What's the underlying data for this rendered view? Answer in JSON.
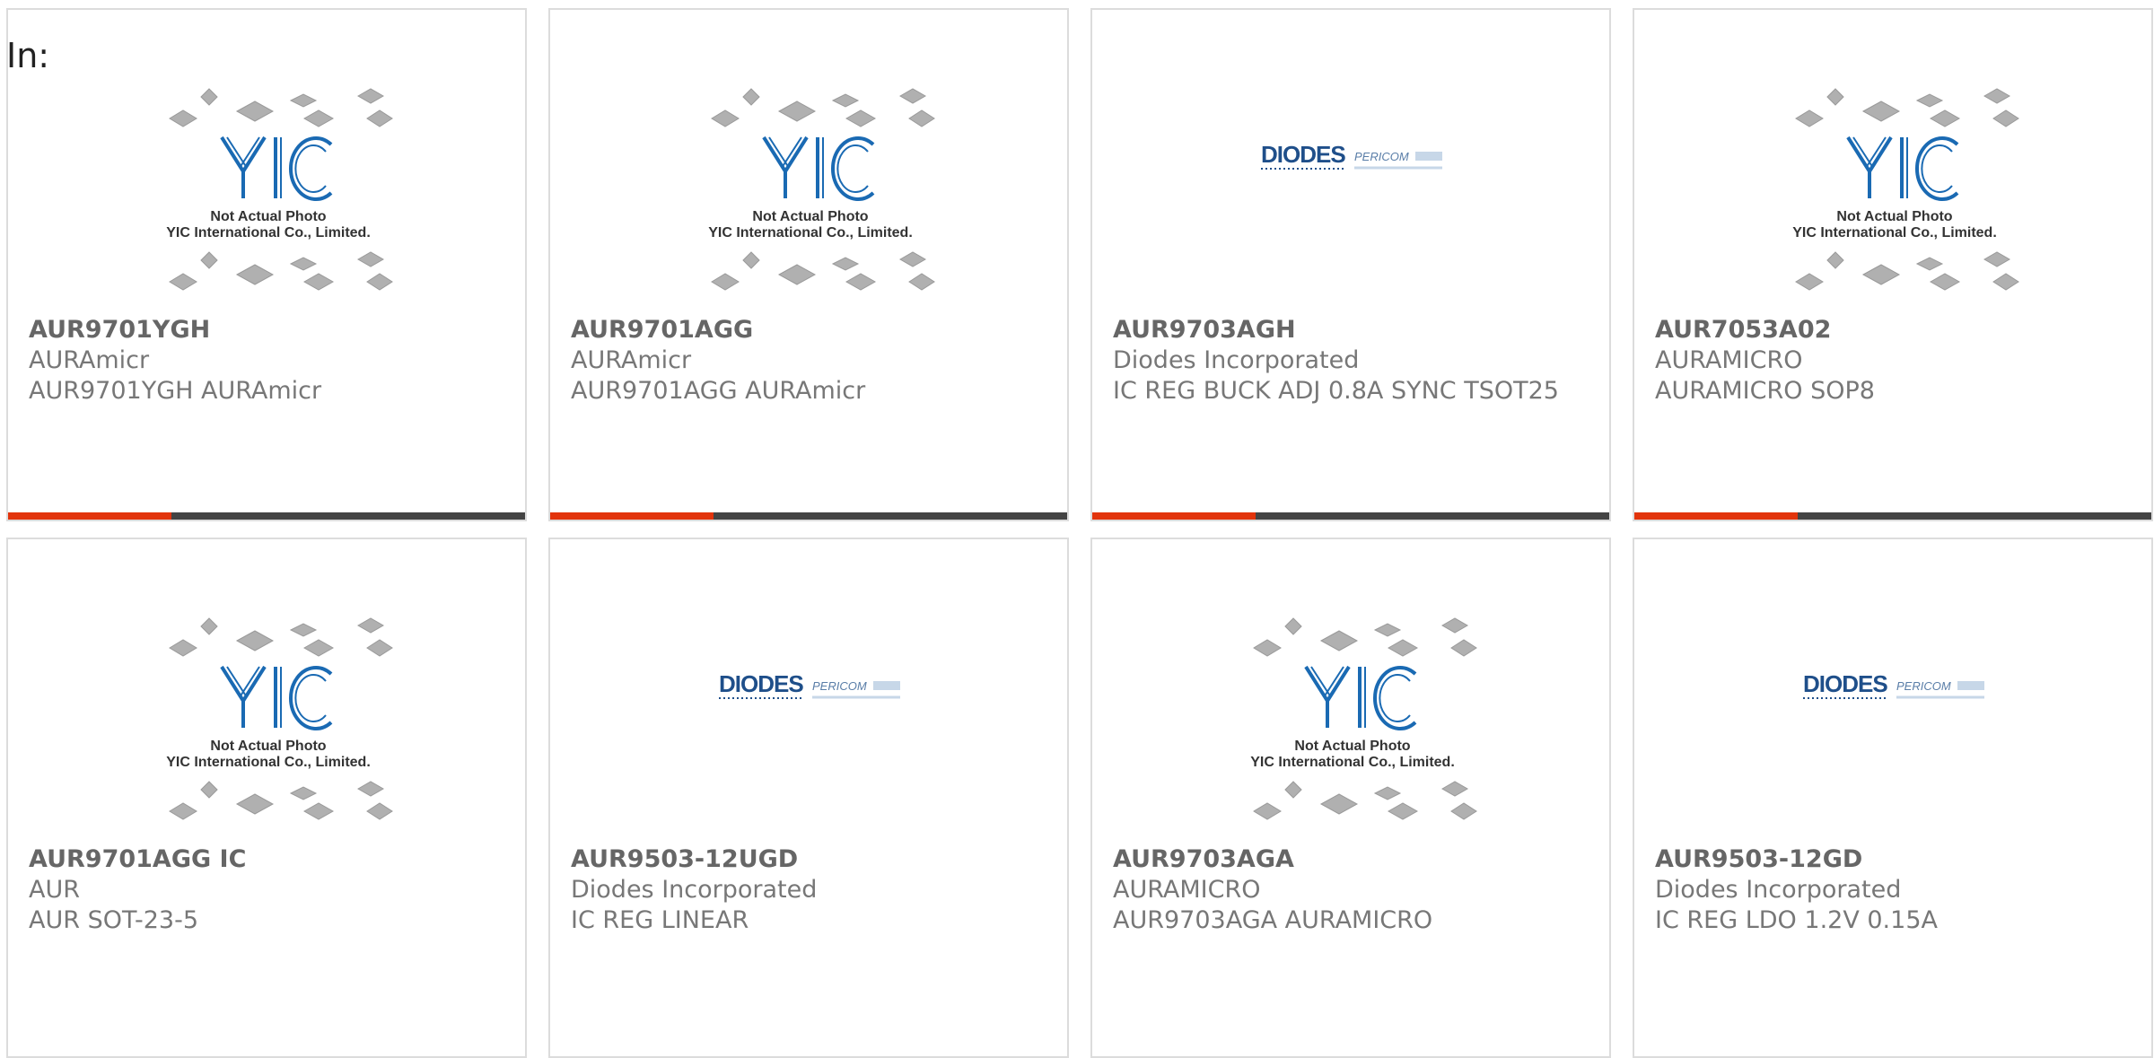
{
  "header": {
    "label": "In:"
  },
  "placeholder": {
    "caption_line1": "Not Actual Photo",
    "caption_line2": "YIC International Co., Limited.",
    "logo_text": "YIC"
  },
  "diodes_logo": {
    "brand": "DIODES",
    "sub_brand": "PERICOM"
  },
  "colors": {
    "accent": "#e2340c",
    "bar": "#444444",
    "logo_blue": "#1a6ab3"
  },
  "products": [
    {
      "part": "AUR9701YGH",
      "maker": "AURAmicr",
      "desc": "AUR9701YGH AURAmicr",
      "image": "yic-placeholder"
    },
    {
      "part": "AUR9701AGG",
      "maker": "AURAmicr",
      "desc": "AUR9701AGG AURAmicr",
      "image": "yic-placeholder"
    },
    {
      "part": "AUR9703AGH",
      "maker": "Diodes Incorporated",
      "desc": "IC REG BUCK ADJ 0.8A SYNC TSOT25",
      "image": "diodes-logo"
    },
    {
      "part": "AUR7053A02",
      "maker": "AURAMICRO",
      "desc": "AURAMICRO SOP8",
      "image": "yic-placeholder"
    },
    {
      "part": "AUR9701AGG IC",
      "maker": "AUR",
      "desc": "AUR SOT-23-5",
      "image": "yic-placeholder"
    },
    {
      "part": "AUR9503-12UGD",
      "maker": "Diodes Incorporated",
      "desc": "IC REG LINEAR",
      "image": "diodes-logo"
    },
    {
      "part": "AUR9703AGA",
      "maker": "AURAMICRO",
      "desc": "AUR9703AGA AURAMICRO",
      "image": "yic-placeholder"
    },
    {
      "part": "AUR9503-12GD",
      "maker": "Diodes Incorporated",
      "desc": "IC REG LDO 1.2V 0.15A",
      "image": "diodes-logo"
    }
  ]
}
